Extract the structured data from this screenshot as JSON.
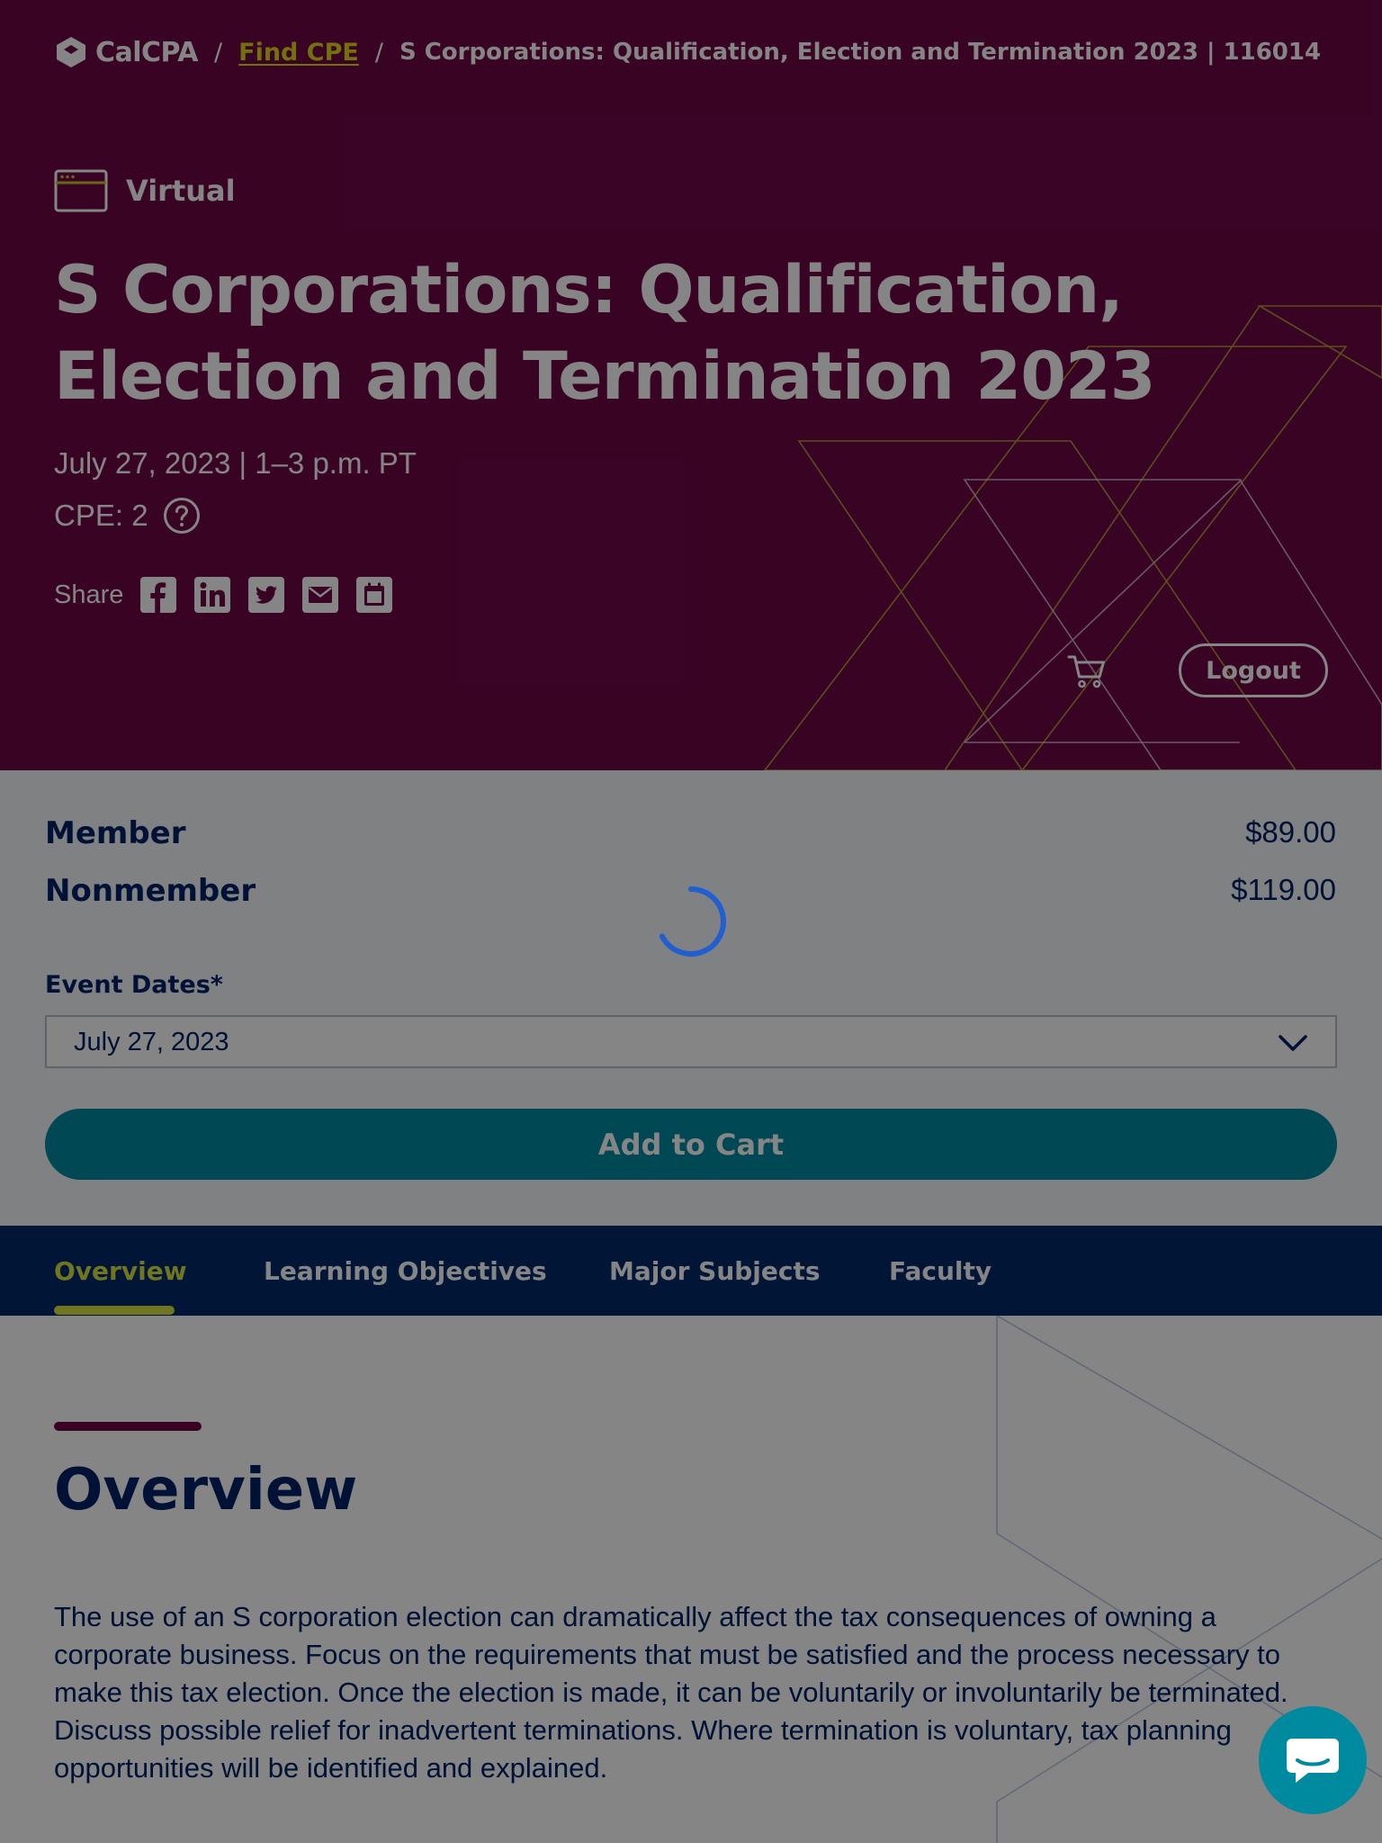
{
  "breadcrumb": {
    "logo_text": "CalCPA",
    "separator": "/",
    "link": "Find CPE",
    "current": "S Corporations: Qualification, Election and Termination 2023 | 116014"
  },
  "event": {
    "format_icon": "browser-window-icon",
    "format": "Virtual",
    "title": "S Corporations: Qualification, Election and Termination 2023",
    "date_time": "July 27, 2023 | 1–3 p.m. PT",
    "cpe": "CPE: 2"
  },
  "share": {
    "label": "Share",
    "icons": [
      "facebook-icon",
      "linkedin-icon",
      "twitter-icon",
      "email-icon",
      "calendar-icon"
    ]
  },
  "header_actions": {
    "cart_icon": "shopping-cart-icon",
    "logout_label": "Logout"
  },
  "pricing": {
    "member_label": "Member",
    "member_price": "$89.00",
    "nonmember_label": "Nonmember",
    "nonmember_price": "$119.00"
  },
  "event_dates": {
    "label": "Event Dates*",
    "selected": "July 27, 2023"
  },
  "add_to_cart_label": "Add to Cart",
  "tabs": [
    {
      "label": "Overview",
      "active": true
    },
    {
      "label": "Learning Objectives",
      "active": false
    },
    {
      "label": "Major Subjects",
      "active": false
    },
    {
      "label": "Faculty",
      "active": false
    }
  ],
  "overview": {
    "heading": "Overview",
    "body": "The use of an S corporation election can dramatically affect the tax consequences of owning a corporate business. Focus on the requirements that must be satisfied and the process necessary to make this tax election. Once the election is made, it can be voluntarily or involuntarily be terminated. Discuss possible relief for inadvertent terminations. Where termination is voluntary, tax planning opportunities will be identified and explained."
  },
  "colors": {
    "hero_bg": "#6d0846",
    "accent_yellow": "#d6e33c",
    "navy": "#012169",
    "teal": "#008a9f",
    "overlay": "rgba(0,0,0,0.48)"
  }
}
